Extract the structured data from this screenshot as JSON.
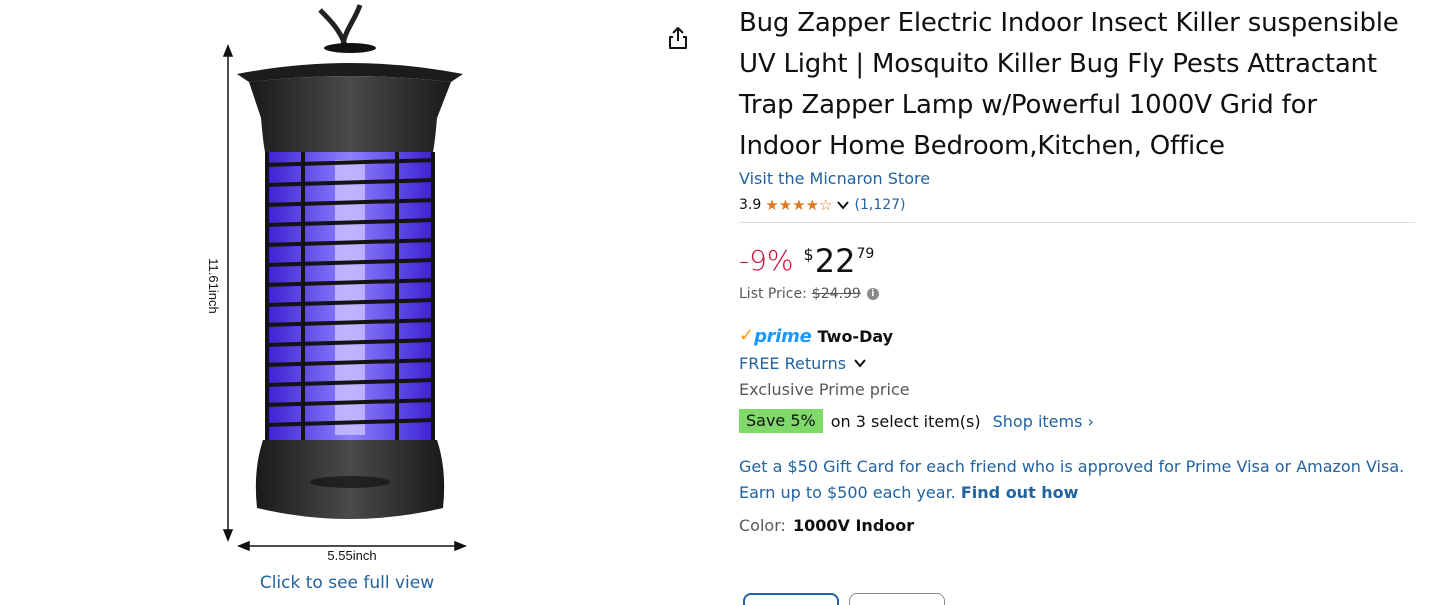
{
  "product": {
    "title": "Bug Zapper Electric Indoor Insect Killer suspensible UV Light | Mosquito Killer Bug Fly Pests Attractant Trap Zapper Lamp w/Powerful 1000V Grid for Indoor Home Bedroom,Kitchen, Office",
    "store_link": "Visit the Micnaron Store",
    "rating": "3.9",
    "stars": "★★★★☆",
    "rating_count": "(1,127)"
  },
  "image": {
    "height_label": "11.61inch",
    "width_label": "5.55inch",
    "see_full_view": "Click to see full view"
  },
  "price": {
    "discount": "-9%",
    "currency": "$",
    "whole": "22",
    "fraction": "79",
    "list_price_label": "List Price:",
    "list_price_value": "$24.99"
  },
  "delivery": {
    "prime_check": "✓",
    "prime_word": "prime",
    "prime_speed": "Two-Day",
    "returns": "FREE Returns",
    "exclusive": "Exclusive Prime price"
  },
  "promo": {
    "badge": "Save 5%",
    "text": "on 3 select item(s)",
    "shop_items": "Shop items ›"
  },
  "gift": {
    "text": "Get a $50 Gift Card for each friend who is approved for Prime Visa or Amazon Visa. Earn up to $500 each year.",
    "link": "Find out how"
  },
  "color": {
    "label": "Color:",
    "value": "1000V Indoor"
  },
  "colors": {
    "star": "#de7921",
    "link": "#2162a1",
    "discount": "#cc0c39",
    "prime": "#1a98ff",
    "save_badge": "#7fda69",
    "uv_glow": "#5a3cff"
  },
  "icons": {
    "share": "share-icon",
    "chevron": "chevron-down-icon",
    "info": "info-icon"
  }
}
